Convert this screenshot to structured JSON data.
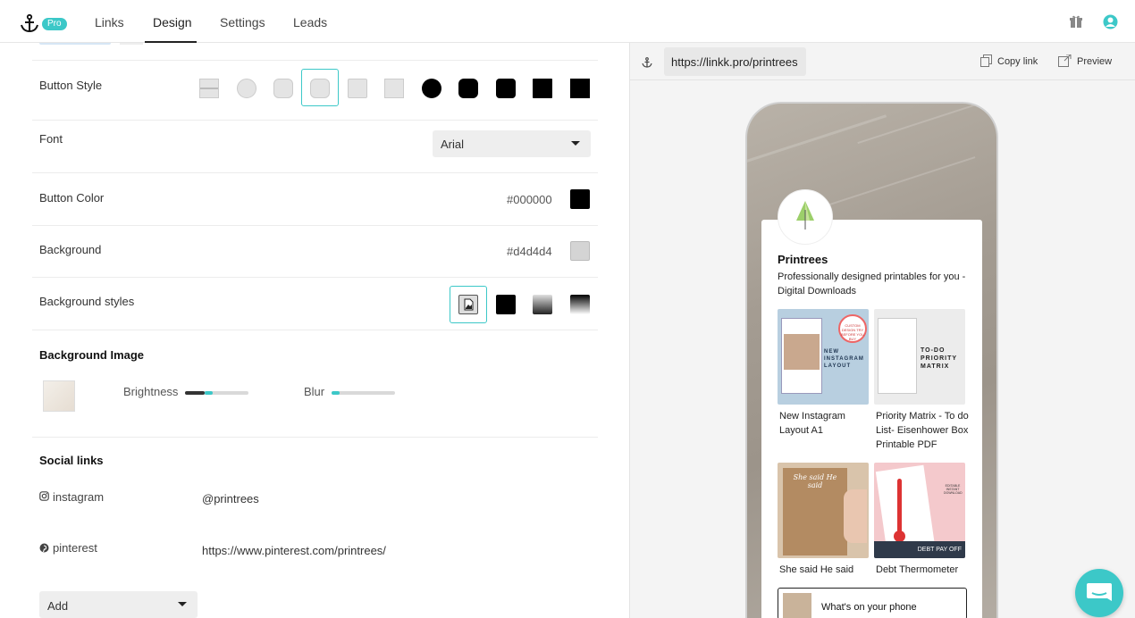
{
  "nav": {
    "pro_badge": "Pro",
    "tabs": [
      {
        "label": "Links"
      },
      {
        "label": "Design"
      },
      {
        "label": "Settings"
      },
      {
        "label": "Leads"
      }
    ],
    "active_tab": "Design"
  },
  "settings": {
    "button_style": {
      "label": "Button Style",
      "styles": [
        "lined",
        "circle-light",
        "rounded-light",
        "rounded-light-selected",
        "square-light",
        "square-light-2",
        "circle-dark",
        "rounded-dark",
        "rounded-dark-2",
        "square-dark",
        "square-dark-2"
      ],
      "selected_index": 3
    },
    "font": {
      "label": "Font",
      "value": "Arial"
    },
    "button_color": {
      "label": "Button Color",
      "hex": "#000000",
      "color": "#000000"
    },
    "background": {
      "label": "Background",
      "hex": "#d4d4d4",
      "color": "#d4d4d4"
    },
    "background_styles": {
      "label": "Background styles",
      "options": [
        "image",
        "solid",
        "gradient-light",
        "gradient-dark"
      ],
      "selected": "image"
    },
    "background_image": {
      "title": "Background Image",
      "brightness_label": "Brightness",
      "brightness_value": 0.38,
      "blur_label": "Blur",
      "blur_value": 0.13
    },
    "social": {
      "title": "Social links",
      "items": [
        {
          "network": "instagram",
          "value": "@printrees"
        },
        {
          "network": "pinterest",
          "value": "https://www.pinterest.com/printrees/"
        }
      ],
      "add_label": "Add"
    }
  },
  "preview": {
    "url": "https://linkk.pro/printrees",
    "copy_label": "Copy link",
    "preview_label": "Preview",
    "profile": {
      "name": "Printrees",
      "description": "Professionally designed printables for you -Digital Downloads"
    },
    "products": [
      {
        "title": "New Instagram Layout A1",
        "image_text": "NEW INSTAGRAM LAYOUT",
        "badge": "CUSTOM DESIGN TRY BEFORE YOU BUY"
      },
      {
        "title": "Priority Matrix - To do List- Eisenhower Box Printable PDF",
        "image_text": "TO-DO PRIORITY MATRIX"
      },
      {
        "title": "She said He said",
        "image_text": "She said He said"
      },
      {
        "title": "Debt Thermometer",
        "image_text": "DEBT PAY OFF",
        "badge": "EDITABLE INSTANT DOWNLOAD"
      }
    ],
    "bottom_link": "What's on your phone"
  },
  "colors": {
    "accent": "#3cc8c8"
  }
}
